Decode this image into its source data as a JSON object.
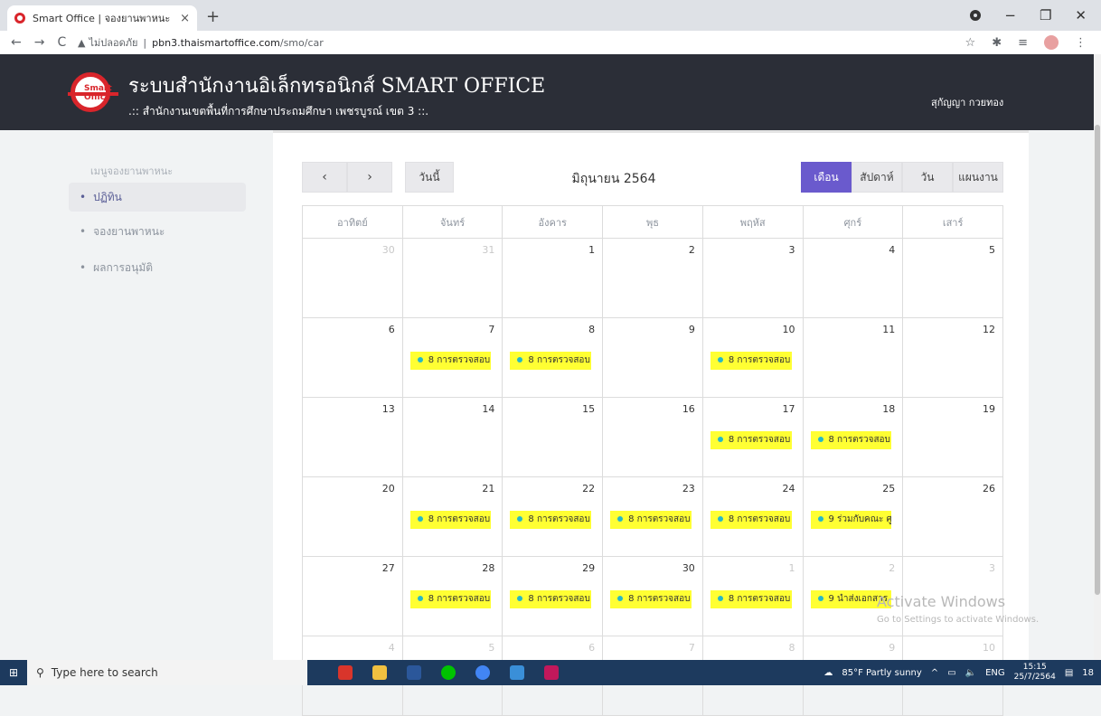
{
  "browser": {
    "tab_title": "Smart Office | จองยานพาหนะ",
    "tab_close": "×",
    "new_tab": "+",
    "nav_back": "←",
    "nav_forward": "→",
    "nav_reload": "C",
    "security_label": "ไม่ปลอดภัย",
    "url_host": "pbn3.thaismartoffice.com",
    "url_path": "/smo/car",
    "win_min": "−",
    "win_max": "❐",
    "win_close": "✕"
  },
  "header": {
    "logo_text": "Smart Office",
    "title": "ระบบสำนักงานอิเล็กทรอนิกส์ SMART OFFICE",
    "subtitle": ".:: สำนักงานเขตพื้นที่การศึกษาประถมศึกษา เพชรบูรณ์ เขต 3 ::.",
    "user": "สุกัญญา กวยทอง"
  },
  "sidebar": {
    "heading": "เมนูจองยานพาหนะ",
    "items": [
      {
        "label": "ปฏิทิน",
        "active": true
      },
      {
        "label": "จองยานพาหนะ",
        "active": false
      },
      {
        "label": "ผลการอนุมัติ",
        "active": false
      }
    ]
  },
  "calendar": {
    "prev": "‹",
    "next": "›",
    "today": "วันนี้",
    "month_title": "มิถุนายน 2564",
    "views": [
      "เดือน",
      "สัปดาห์",
      "วัน",
      "แผนงาน"
    ],
    "active_view": "เดือน",
    "weekdays": [
      "อาทิตย์",
      "จันทร์",
      "อังคาร",
      "พุธ",
      "พฤหัส",
      "ศุกร์",
      "เสาร์"
    ],
    "weeks": [
      [
        {
          "d": "30",
          "o": true
        },
        {
          "d": "31",
          "o": true
        },
        {
          "d": "1"
        },
        {
          "d": "2"
        },
        {
          "d": "3"
        },
        {
          "d": "4"
        },
        {
          "d": "5"
        }
      ],
      [
        {
          "d": "6"
        },
        {
          "d": "7",
          "e": "8 การตรวจสอบ"
        },
        {
          "d": "8",
          "e": "8 การตรวจสอบ"
        },
        {
          "d": "9"
        },
        {
          "d": "10",
          "e": "8 การตรวจสอบ"
        },
        {
          "d": "11"
        },
        {
          "d": "12"
        }
      ],
      [
        {
          "d": "13"
        },
        {
          "d": "14"
        },
        {
          "d": "15"
        },
        {
          "d": "16"
        },
        {
          "d": "17",
          "e": "8 การตรวจสอบ"
        },
        {
          "d": "18",
          "e": "8 การตรวจสอบ"
        },
        {
          "d": "19"
        }
      ],
      [
        {
          "d": "20"
        },
        {
          "d": "21",
          "e": "8 การตรวจสอบ"
        },
        {
          "d": "22",
          "e": "8 การตรวจสอบ"
        },
        {
          "d": "23",
          "e": "8 การตรวจสอบ"
        },
        {
          "d": "24",
          "e": "8 การตรวจสอบ"
        },
        {
          "d": "25",
          "e": "9 ร่วมกับคณะ ศู"
        },
        {
          "d": "26"
        }
      ],
      [
        {
          "d": "27"
        },
        {
          "d": "28",
          "e": "8 การตรวจสอบ"
        },
        {
          "d": "29",
          "e": "8 การตรวจสอบ"
        },
        {
          "d": "30",
          "e": "8 การตรวจสอบ"
        },
        {
          "d": "1",
          "o": true,
          "e": "8 การตรวจสอบ"
        },
        {
          "d": "2",
          "o": true,
          "e": "9 นำส่งเอกสาร"
        },
        {
          "d": "3",
          "o": true
        }
      ],
      [
        {
          "d": "4",
          "o": true
        },
        {
          "d": "5",
          "o": true
        },
        {
          "d": "6",
          "o": true
        },
        {
          "d": "7",
          "o": true
        },
        {
          "d": "8",
          "o": true
        },
        {
          "d": "9",
          "o": true
        },
        {
          "d": "10",
          "o": true
        }
      ]
    ]
  },
  "watermark": {
    "line1": "Activate Windows",
    "line2": "Go to Settings to activate Windows."
  },
  "taskbar": {
    "search_placeholder": "Type here to search",
    "weather": "85°F Partly sunny",
    "lang": "ENG",
    "time": "15:15",
    "date": "25/7/2564",
    "notif_count": "18"
  },
  "colors": {
    "header_bg": "#2b2e37",
    "accent": "#6a5acd",
    "event_bg": "#ffff33",
    "event_dot": "#26b8c8"
  }
}
